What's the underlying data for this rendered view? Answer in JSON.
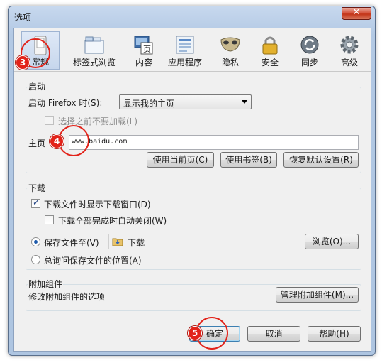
{
  "window": {
    "title": "选项",
    "close_glyph": "✕"
  },
  "toolbar": {
    "panes": [
      {
        "label": "常规",
        "icon": "general-switch-icon",
        "selected": true
      },
      {
        "label": "标签式浏览",
        "icon": "tabs-icon"
      },
      {
        "label": "内容",
        "icon": "content-icon",
        "icon_text": "页"
      },
      {
        "label": "应用程序",
        "icon": "applications-icon"
      },
      {
        "label": "隐私",
        "icon": "privacy-mask-icon"
      },
      {
        "label": "安全",
        "icon": "security-lock-icon"
      },
      {
        "label": "同步",
        "icon": "sync-icon"
      },
      {
        "label": "高级",
        "icon": "advanced-gear-icon"
      }
    ]
  },
  "startup": {
    "group_title": "启动",
    "when_label": "启动 Firefox 时(S):",
    "when_value": "显示我的主页",
    "dont_load_tabs_label": "选择之前不要加载(L)",
    "homepage_label": "主页",
    "homepage_value": "www.baidu.com",
    "use_current_button": "使用当前页(C)",
    "use_bookmark_button": "使用书签(B)",
    "restore_default_button": "恢复默认设置(R)"
  },
  "downloads": {
    "group_title": "下载",
    "show_window_label": "下载文件时显示下载窗口(D)",
    "close_when_done_label": "下载全部完成时自动关闭(W)",
    "save_to_label": "保存文件至(V)",
    "folder_name": "下载",
    "browse_button": "浏览(O)...",
    "always_ask_label": "总询问保存文件的位置(A)",
    "show_window_checked": true,
    "close_when_done_checked": false,
    "save_to_selected": true
  },
  "addons": {
    "group_title": "附加组件",
    "description": "修改附加组件的选项",
    "manage_button": "管理附加组件(M)..."
  },
  "dialog_buttons": {
    "ok": "确定",
    "cancel": "取消",
    "help": "帮助(H)"
  },
  "annotations": {
    "badge_3": "3",
    "badge_4": "4",
    "badge_5": "5",
    "color": "#e2231a"
  },
  "colors": {
    "title_gradient_top": "#c7d8ee",
    "close_red": "#c33418",
    "client_bg": "#f0f0f0"
  }
}
